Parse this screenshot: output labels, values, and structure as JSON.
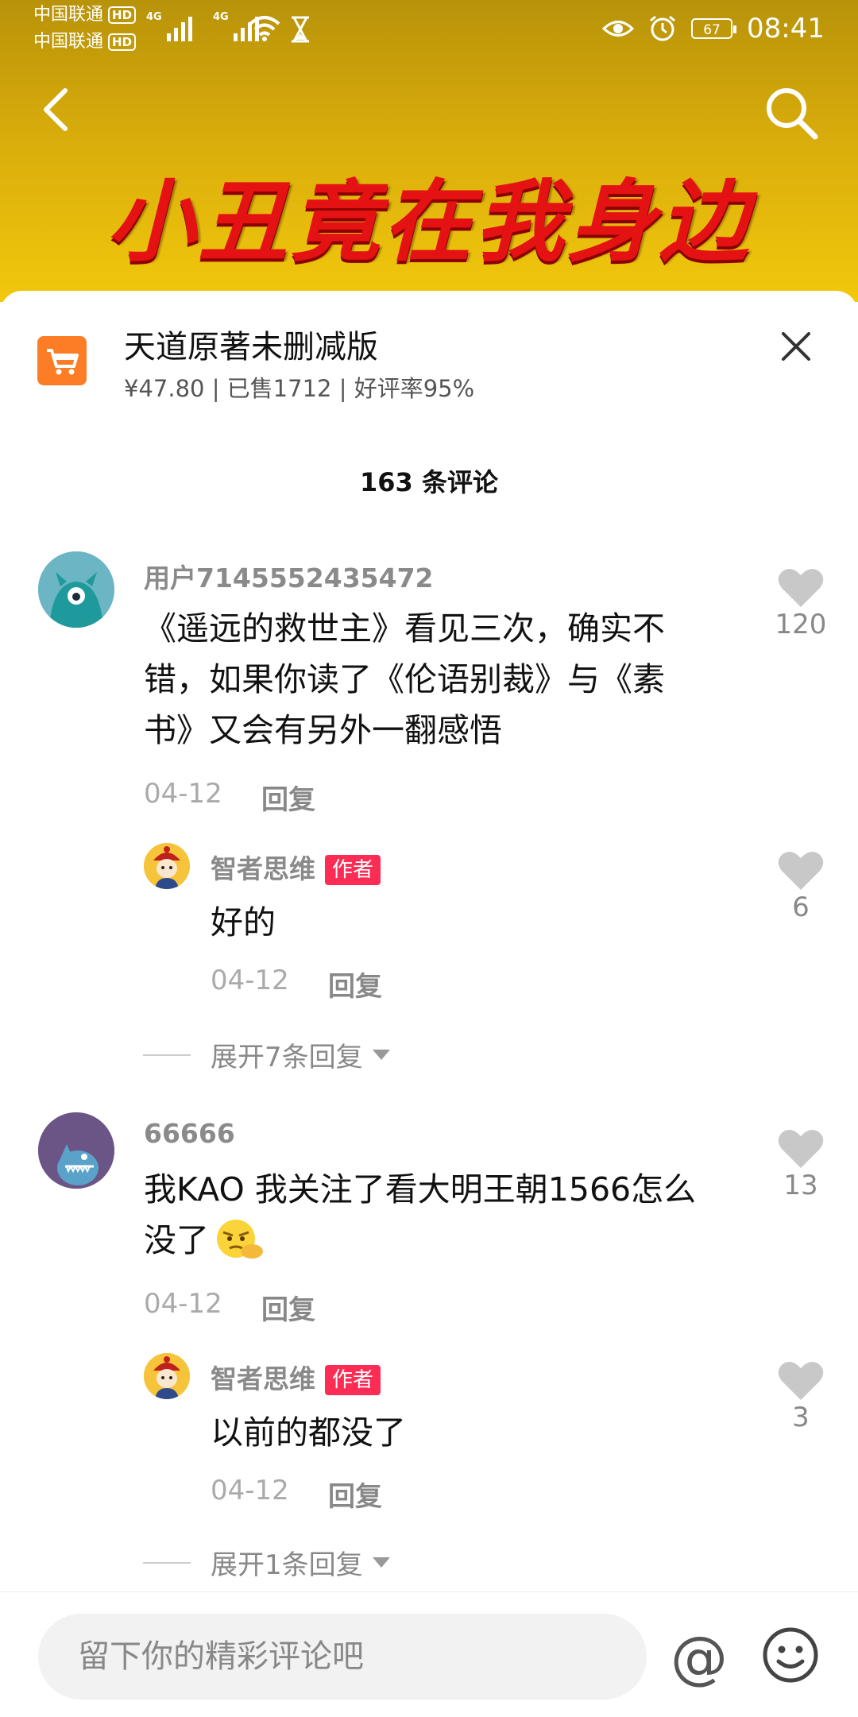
{
  "status_bar": {
    "carrier1": "中国联通",
    "carrier2": "中国联通",
    "hd": "HD",
    "net": "4G",
    "battery": "67",
    "time": "08:41"
  },
  "header": {
    "banner_text": "小丑竟在我身边"
  },
  "product": {
    "title": "天道原著未删减版",
    "meta": "¥47.80 | 已售1712 | 好评率95%"
  },
  "comments_count": "163 条评论",
  "comments": [
    {
      "user": "用户7145552435472",
      "text_line1": "《遥远的救世主》看见三次，确实不",
      "text_line2": "错，如果你读了《伦语别裁》与《素",
      "text_line3": "书》又会有另外一翻感悟",
      "date": "04-12",
      "reply": "回复",
      "likes": "120",
      "sub": {
        "user": "智者思维",
        "badge": "作者",
        "text": "好的",
        "date": "04-12",
        "reply": "回复",
        "likes": "6"
      },
      "expand": "展开7条回复"
    },
    {
      "user": "66666",
      "text_line1": "我KAO 我关注了看大明王朝1566怎么",
      "text_line2": "没了",
      "date": "04-12",
      "reply": "回复",
      "likes": "13",
      "sub": {
        "user": "智者思维",
        "badge": "作者",
        "text": "以前的都没了",
        "date": "04-12",
        "reply": "回复",
        "likes": "3"
      },
      "expand": "展开1条回复"
    }
  ],
  "input": {
    "placeholder": "留下你的精彩评论吧",
    "at_symbol": "@"
  },
  "icons": [
    "back-arrow-icon",
    "search-icon",
    "cart-icon",
    "close-icon",
    "heart-icon",
    "smiley-icon",
    "emoji-thinking-icon"
  ],
  "colors": {
    "accent_red": "#fd2c55",
    "cart_orange": "#fd7c26",
    "header_yellow": "#f2c80c"
  }
}
